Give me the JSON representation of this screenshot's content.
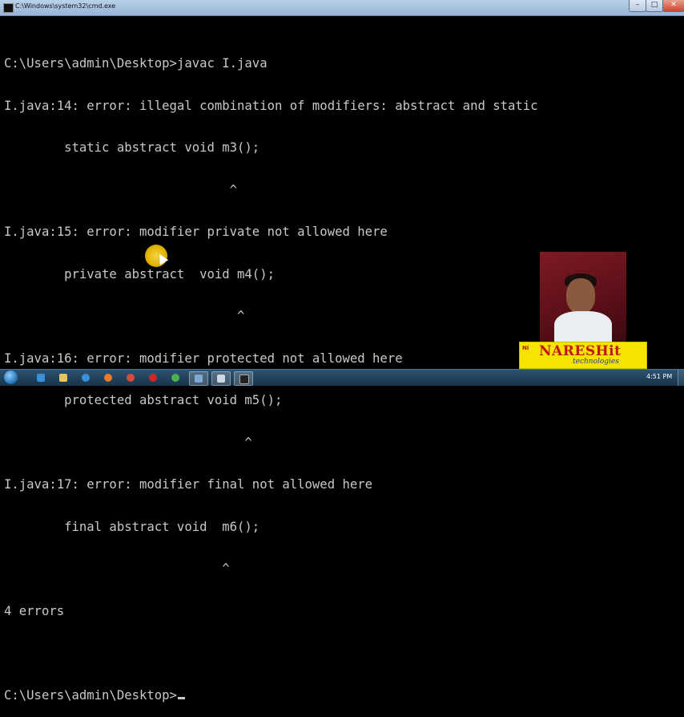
{
  "window": {
    "title": "C:\\Windows\\system32\\cmd.exe",
    "minimize_label": "–",
    "maximize_label": "□",
    "close_label": "✕"
  },
  "console": {
    "lines": [
      "C:\\Users\\admin\\Desktop>javac I.java",
      "I.java:14: error: illegal combination of modifiers: abstract and static",
      "        static abstract void m3();",
      "                              ^",
      "I.java:15: error: modifier private not allowed here",
      "        private abstract  void m4();",
      "                               ^",
      "I.java:16: error: modifier protected not allowed here",
      "        protected abstract void m5();",
      "                                ^",
      "I.java:17: error: modifier final not allowed here",
      "        final abstract void  m6();",
      "                             ^",
      "4 errors",
      "",
      "C:\\Users\\admin\\Desktop>"
    ]
  },
  "overlay": {
    "brand_prefix": "Ni",
    "brand_name": "NARESHit",
    "brand_sub": "technologies"
  },
  "taskbar": {
    "icons": [
      "start-orb",
      "ie-icon",
      "explorer-icon",
      "media-player-icon",
      "firefox-icon",
      "chrome-icon",
      "opera-icon",
      "chrome-alt-icon",
      "virtualbox-icon",
      "files-icon",
      "cmd-icon"
    ],
    "clock": "4:51 PM"
  },
  "colors": {
    "console_bg": "#000000",
    "console_text": "#c8c8c8",
    "titlebar": "#b9d1ea",
    "taskbar": "#1f4160",
    "logo_bg": "#f6e400",
    "logo_red": "#c01818",
    "logo_blue": "#1a3d9a"
  }
}
